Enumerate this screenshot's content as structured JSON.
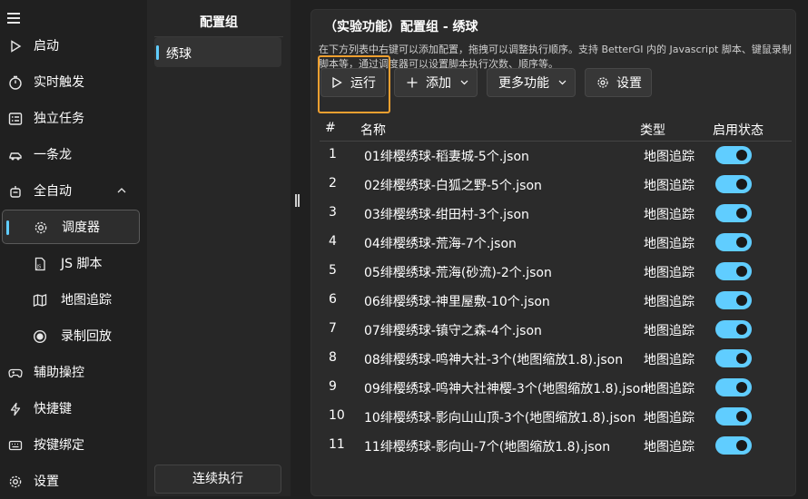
{
  "nav": {
    "items": [
      {
        "id": "start",
        "label": "启动",
        "icon": "play-icon"
      },
      {
        "id": "realtime",
        "label": "实时触发",
        "icon": "timer-icon"
      },
      {
        "id": "tasks",
        "label": "独立任务",
        "icon": "task-list-icon"
      },
      {
        "id": "dragon",
        "label": "一条龙",
        "icon": "car-icon"
      },
      {
        "id": "auto",
        "label": "全自动",
        "icon": "robot-icon"
      },
      {
        "id": "scheduler",
        "label": "调度器",
        "icon": "gear-icon"
      },
      {
        "id": "js",
        "label": "JS 脚本",
        "icon": "js-file-icon"
      },
      {
        "id": "map",
        "label": "地图追踪",
        "icon": "map-icon"
      },
      {
        "id": "record",
        "label": "录制回放",
        "icon": "record-icon"
      },
      {
        "id": "assist",
        "label": "辅助操控",
        "icon": "gamepad-icon"
      },
      {
        "id": "hotkey",
        "label": "快捷键",
        "icon": "lightning-icon"
      },
      {
        "id": "keybind",
        "label": "按键绑定",
        "icon": "keyboard-icon"
      },
      {
        "id": "settings",
        "label": "设置",
        "icon": "settings-icon"
      }
    ]
  },
  "groups": {
    "header": "配置组",
    "items": [
      {
        "label": "绣球"
      }
    ],
    "run_all_label": "连续执行"
  },
  "main": {
    "title": "（实验功能）配置组 - 绣球",
    "description": "在下方列表中右键可以添加配置，拖拽可以调整执行顺序。支持 BetterGI 内的 Javascript 脚本、键鼠录制脚本等，通过调度器可以设置脚本执行次数、顺序等。",
    "toolbar": {
      "run": "运行",
      "add": "添加",
      "more": "更多功能",
      "settings": "设置"
    },
    "table": {
      "headers": {
        "num": "#",
        "name": "名称",
        "type": "类型",
        "status": "启用状态"
      },
      "rows": [
        {
          "num": "1",
          "name": "01绯樱绣球-稻妻城-5个.json",
          "type": "地图追踪",
          "enabled": true
        },
        {
          "num": "2",
          "name": "02绯樱绣球-白狐之野-5个.json",
          "type": "地图追踪",
          "enabled": true
        },
        {
          "num": "3",
          "name": "03绯樱绣球-绀田村-3个.json",
          "type": "地图追踪",
          "enabled": true
        },
        {
          "num": "4",
          "name": "04绯樱绣球-荒海-7个.json",
          "type": "地图追踪",
          "enabled": true
        },
        {
          "num": "5",
          "name": "05绯樱绣球-荒海(砂流)-2个.json",
          "type": "地图追踪",
          "enabled": true
        },
        {
          "num": "6",
          "name": "06绯樱绣球-神里屋敷-10个.json",
          "type": "地图追踪",
          "enabled": true
        },
        {
          "num": "7",
          "name": "07绯樱绣球-镇守之森-4个.json",
          "type": "地图追踪",
          "enabled": true
        },
        {
          "num": "8",
          "name": "08绯樱绣球-鸣神大社-3个(地图缩放1.8).json",
          "type": "地图追踪",
          "enabled": true
        },
        {
          "num": "9",
          "name": "09绯樱绣球-鸣神大社神樱-3个(地图缩放1.8).json",
          "type": "地图追踪",
          "enabled": true
        },
        {
          "num": "10",
          "name": "10绯樱绣球-影向山山顶-3个(地图缩放1.8).json",
          "type": "地图追踪",
          "enabled": true
        },
        {
          "num": "11",
          "name": "11绯樱绣球-影向山-7个(地图缩放1.8).json",
          "type": "地图追踪",
          "enabled": true
        }
      ]
    }
  },
  "colors": {
    "accent": "#60cdff",
    "highlight": "#f0a030",
    "background": "#202020",
    "panel": "#2b2b2b"
  }
}
